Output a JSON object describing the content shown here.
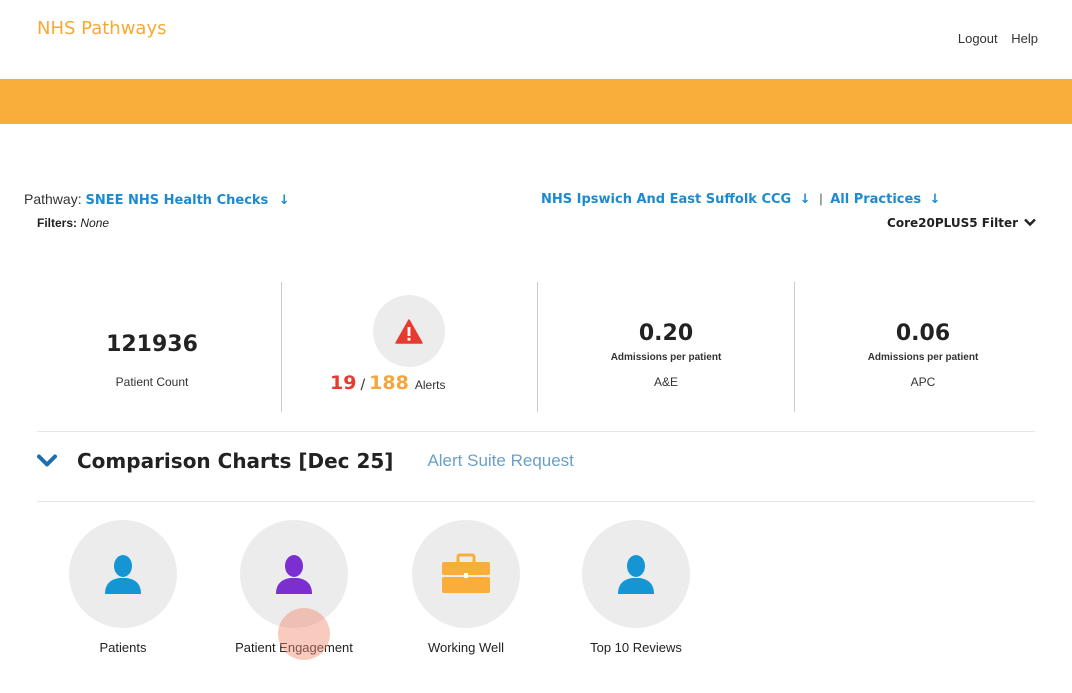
{
  "header": {
    "brand": "NHS Pathways",
    "links": [
      "Logout",
      "Help"
    ]
  },
  "selectors": {
    "pathway_label": "Pathway:",
    "pathway_value": "SNEE NHS Health Checks",
    "arrow": "↓",
    "filters_label": "Filters:",
    "filters_value": "None",
    "org_value": "NHS Ipswich And East Suffolk CCG",
    "sep": "|",
    "practices_value": "All Practices",
    "core_filter": "Core20PLUS5 Filter"
  },
  "stats": {
    "patient_count_value": "121936",
    "patient_count_label": "Patient Count",
    "alerts_red": "19",
    "alerts_slash": "/",
    "alerts_total": "188",
    "alerts_label": "Alerts",
    "ae_value": "0.20",
    "ae_sub": "Admissions per patient",
    "ae_label": "A&E",
    "apc_value": "0.06",
    "apc_sub": "Admissions per patient",
    "apc_label": "APC"
  },
  "section": {
    "title": "Comparison Charts [Dec 25]",
    "request_link": "Alert Suite Request"
  },
  "tiles": [
    {
      "label": "Patients"
    },
    {
      "label": "Patient Engagement"
    },
    {
      "label": "Working Well"
    },
    {
      "label": "Top 10 Reviews"
    }
  ],
  "colors": {
    "brand": "#f9a832",
    "banner": "#f9ae3b",
    "link": "#1b8bd1",
    "alert_red": "#e63b2e",
    "alert_orange": "#f5a53a",
    "icon_blue": "#1595d3",
    "icon_purple": "#7b2fd0",
    "icon_orange": "#f9ae3b"
  },
  "icons": [
    "warning-icon",
    "chevron-down-icon",
    "user-icon",
    "briefcase-icon"
  ]
}
